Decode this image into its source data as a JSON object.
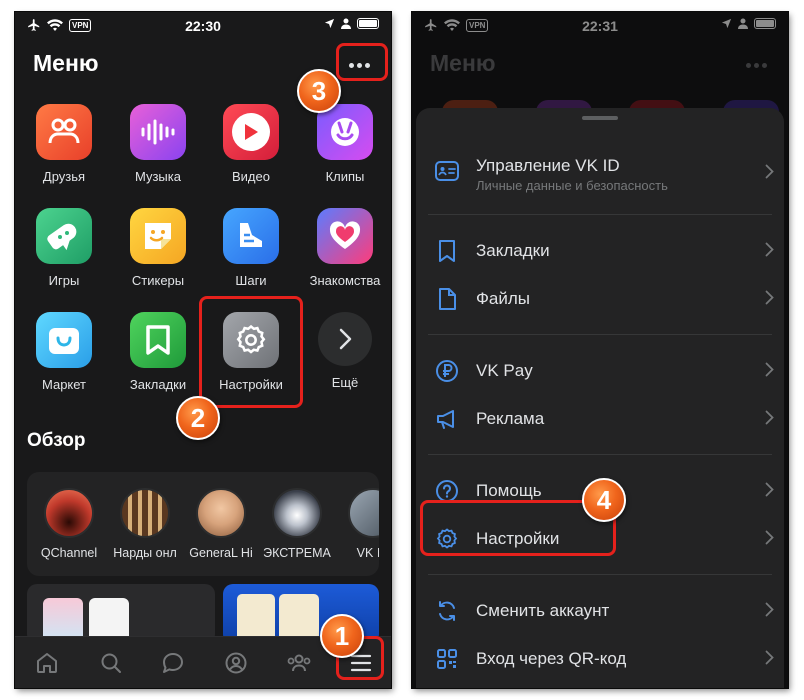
{
  "status_left": {
    "time": "22:30",
    "vpn": "VPN"
  },
  "status_right": {
    "time": "22:31",
    "vpn": "VPN"
  },
  "menu_title": "Меню",
  "apps": [
    {
      "label": "Друзья",
      "icon": "friends-icon",
      "color": "#f05a3a"
    },
    {
      "label": "Музыка",
      "icon": "music-icon",
      "color": "#b44fe8"
    },
    {
      "label": "Видео",
      "icon": "video-icon",
      "color": "#f0323c"
    },
    {
      "label": "Клипы",
      "icon": "clips-icon",
      "color": "#a84cf0"
    },
    {
      "label": "Игры",
      "icon": "games-icon",
      "color": "#2fb87a"
    },
    {
      "label": "Стикеры",
      "icon": "stickers-icon",
      "color": "#f5c324"
    },
    {
      "label": "Шаги",
      "icon": "steps-icon",
      "color": "#3a8ef0"
    },
    {
      "label": "Знакомства",
      "icon": "dating-icon",
      "color": "#f03c6e"
    },
    {
      "label": "Маркет",
      "icon": "market-icon",
      "color": "#2db6e8"
    },
    {
      "label": "Закладки",
      "icon": "bookmarks-icon",
      "color": "#33b24a"
    },
    {
      "label": "Настройки",
      "icon": "settings-icon",
      "color": "#8d9096"
    },
    {
      "label": "Ещё",
      "icon": "chevron-right-icon",
      "color": "#2c2d2e"
    }
  ],
  "overview_title": "Обзор",
  "overview_items": [
    {
      "label": "QChannel",
      "color": "#c0392b"
    },
    {
      "label": "Нарды онл",
      "color": "#7a5230"
    },
    {
      "label": "GeneraL Hi",
      "color": "#d7a37c"
    },
    {
      "label": "ЭКСТРЕМА",
      "color": "#444a55"
    },
    {
      "label": "VK IN",
      "color": "#6f7a86"
    }
  ],
  "sheet": {
    "items": [
      {
        "label": "Управление VK ID",
        "sub": "Личные данные и безопасность",
        "icon": "id-card-icon"
      },
      {
        "label": "Закладки",
        "icon": "bookmark-icon"
      },
      {
        "label": "Файлы",
        "icon": "file-icon"
      },
      {
        "label": "VK Pay",
        "icon": "ruble-icon"
      },
      {
        "label": "Реклама",
        "icon": "megaphone-icon"
      },
      {
        "label": "Помощь",
        "icon": "help-icon"
      },
      {
        "label": "Настройки",
        "icon": "gear-icon"
      },
      {
        "label": "Сменить аккаунт",
        "icon": "switch-account-icon"
      },
      {
        "label": "Вход через QR-код",
        "icon": "qr-code-icon"
      }
    ]
  },
  "markers": [
    "1",
    "2",
    "3",
    "4"
  ],
  "colors": {
    "highlight": "#e5211c",
    "badge": "#f0651c",
    "accent_icon": "#4a8fe7"
  }
}
